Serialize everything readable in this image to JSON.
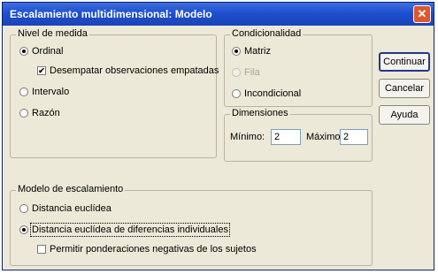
{
  "window": {
    "title": "Escalamiento multidimensional: Modelo",
    "close_glyph": "✕"
  },
  "nivel": {
    "legend": "Nivel de medida",
    "options": [
      {
        "label": "Ordinal",
        "selected": true
      },
      {
        "label": "Intervalo",
        "selected": false
      },
      {
        "label": "Razón",
        "selected": false
      }
    ],
    "tie_checkbox": {
      "label": "Desempatar observaciones empatadas",
      "checked": true
    }
  },
  "condicionalidad": {
    "legend": "Condicionalidad",
    "options": [
      {
        "label": "Matriz",
        "selected": true,
        "enabled": true
      },
      {
        "label": "Fila",
        "selected": false,
        "enabled": false
      },
      {
        "label": "Incondicional",
        "selected": false,
        "enabled": true
      }
    ]
  },
  "dimensiones": {
    "legend": "Dimensiones",
    "min_label": "Mínimo:",
    "min_value": "2",
    "max_label": "Máximo:",
    "max_value": "2"
  },
  "modelo": {
    "legend": "Modelo de escalamiento",
    "options": [
      {
        "label": "Distancia euclídea",
        "selected": false
      },
      {
        "label": "Distancia euclídea de diferencias individuales",
        "selected": true
      }
    ],
    "neg_checkbox": {
      "label": "Permitir ponderaciones negativas de los sujetos",
      "checked": false
    }
  },
  "buttons": {
    "continue": "Continuar",
    "cancel": "Cancelar",
    "help": "Ayuda"
  },
  "colors": {
    "titlebar": "#1e4fcf",
    "dialog_bg": "#ece9d8",
    "close": "#e0562f"
  },
  "icons": {
    "check": "✔",
    "close": "close-icon"
  }
}
